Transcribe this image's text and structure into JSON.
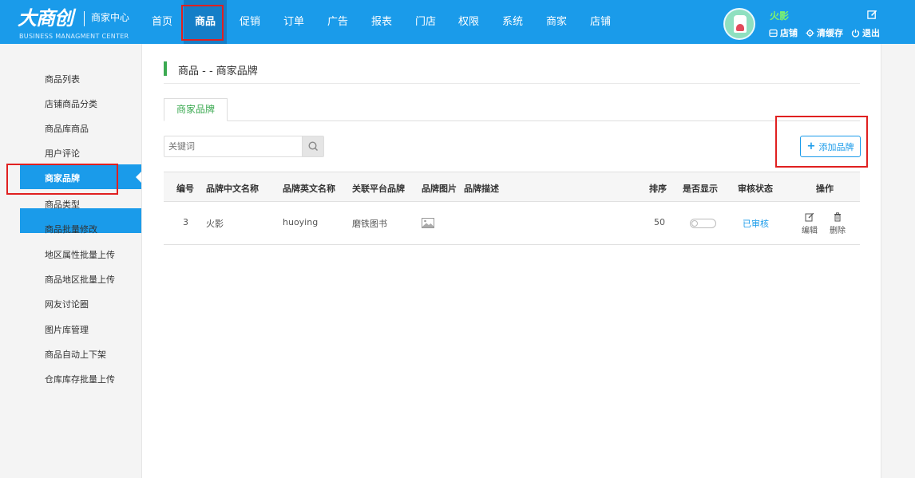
{
  "brand": {
    "logo_main": "大商创",
    "logo_sub": "商家中心",
    "logo_en": "BUSINESS MANAGMENT CENTER"
  },
  "nav": {
    "items": [
      {
        "label": "首页"
      },
      {
        "label": "商品"
      },
      {
        "label": "促销"
      },
      {
        "label": "订单"
      },
      {
        "label": "广告"
      },
      {
        "label": "报表"
      },
      {
        "label": "门店"
      },
      {
        "label": "权限"
      },
      {
        "label": "系统"
      },
      {
        "label": "商家"
      },
      {
        "label": "店铺"
      }
    ],
    "active_index": 1
  },
  "user": {
    "name": "火影",
    "actions": [
      {
        "label": "店铺",
        "icon": "store-icon"
      },
      {
        "label": "清缓存",
        "icon": "gear-icon"
      },
      {
        "label": "退出",
        "icon": "power-icon"
      }
    ]
  },
  "sidebar": {
    "items": [
      {
        "label": "商品列表"
      },
      {
        "label": "店铺商品分类"
      },
      {
        "label": "商品库商品"
      },
      {
        "label": "用户评论"
      },
      {
        "label": "商家品牌"
      },
      {
        "label": "商品类型"
      },
      {
        "label": "商品批量修改"
      },
      {
        "label": "地区属性批量上传"
      },
      {
        "label": "商品地区批量上传"
      },
      {
        "label": "网友讨论圈"
      },
      {
        "label": "图片库管理"
      },
      {
        "label": "商品自动上下架"
      },
      {
        "label": "仓库库存批量上传"
      }
    ],
    "active_index": 4
  },
  "main": {
    "title": "商品 - - 商家品牌",
    "tab_label": "商家品牌",
    "search_placeholder": "关键词",
    "add_button_label": "添加品牌",
    "table": {
      "headers": [
        "编号",
        "品牌中文名称",
        "品牌英文名称",
        "关联平台品牌",
        "品牌图片",
        "品牌描述",
        "排序",
        "是否显示",
        "审核状态",
        "操作"
      ],
      "rows": [
        {
          "id": "3",
          "name_cn": "火影",
          "name_en": "huoying",
          "platform_brand": "磨铁图书",
          "sort": "50",
          "show": false,
          "status": "已审核",
          "edit_label": "编辑",
          "delete_label": "删除"
        }
      ]
    }
  },
  "colors": {
    "primary": "#1a9bea",
    "accent_green": "#3caa52",
    "highlight_red": "#e02020"
  }
}
